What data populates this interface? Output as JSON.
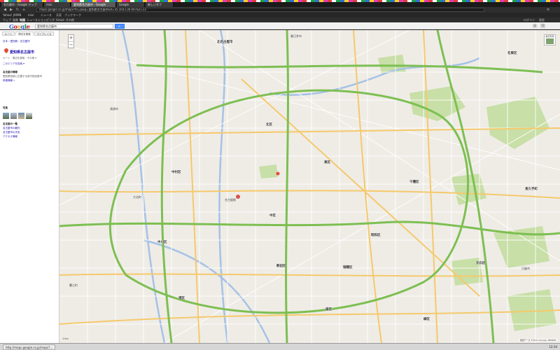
{
  "browser": {
    "tabs": [
      {
        "label": "名古屋市 - Google マップ",
        "active": false
      },
      {
        "label": "mixi",
        "active": false
      },
      {
        "label": "愛知県名古屋市 - Google",
        "active": true
      },
      {
        "label": "Google",
        "active": false
      },
      {
        "label": "新しいタブ",
        "active": false
      }
    ],
    "url": "maps.google.co.jp/maps?hl=ja&q=愛知県名古屋市&ll=35.164,136.907&z=13",
    "bookmarks": [
      "Yahoo! JAPAN",
      "mixi",
      "ニュース",
      "天気",
      "ブックマーク"
    ]
  },
  "gbar": {
    "items": [
      "ウェブ",
      "画像",
      "地図",
      "ニュース",
      "ショッピング",
      "Gmail",
      "その他"
    ],
    "right": [
      "ログイン",
      "設定"
    ]
  },
  "header": {
    "logo_letters": [
      {
        "ch": "G",
        "color": "#3369e8"
      },
      {
        "ch": "o",
        "color": "#d50f25"
      },
      {
        "ch": "o",
        "color": "#eeb211"
      },
      {
        "ch": "g",
        "color": "#3369e8"
      },
      {
        "ch": "l",
        "color": "#009925"
      },
      {
        "ch": "e",
        "color": "#d50f25"
      }
    ],
    "search_value": "愛知県名古屋市",
    "search_icon": "search-icon"
  },
  "panel": {
    "tabs": [
      "ルート",
      "周辺を検索",
      "マイプレイス"
    ],
    "breadcrumb": "日本 › 愛知県 › 名古屋市",
    "result_title": "愛知県名古屋市",
    "actions": "ルート · 周辺を検索 · その他 ▾",
    "more_info": "このエリアを探索 ▾",
    "section_label": "名古屋の情報",
    "desc_1": "愛知県西部に位置する政令指定都市",
    "desc_2": "詳細情報 »",
    "photos_label": "写真",
    "links_head": "名古屋の一覧",
    "links": [
      "名古屋市の観光",
      "名古屋市の天気",
      "アクセス情報"
    ]
  },
  "map": {
    "labels": [
      {
        "text": "北名古屋市",
        "ward": true
      },
      {
        "text": "春日井市",
        "ward": false
      },
      {
        "text": "名東区",
        "ward": true
      },
      {
        "text": "清須市",
        "ward": false
      },
      {
        "text": "北区",
        "ward": true
      },
      {
        "text": "中村区",
        "ward": true
      },
      {
        "text": "東区",
        "ward": true
      },
      {
        "text": "名古屋駅",
        "ward": false
      },
      {
        "text": "中区",
        "ward": true
      },
      {
        "text": "千種区",
        "ward": true
      },
      {
        "text": "長久手町",
        "ward": true
      },
      {
        "text": "大治町",
        "ward": false
      },
      {
        "text": "中川区",
        "ward": true
      },
      {
        "text": "昭和区",
        "ward": true
      },
      {
        "text": "瑞穂区",
        "ward": true
      },
      {
        "text": "天白区",
        "ward": true
      },
      {
        "text": "港区",
        "ward": true
      },
      {
        "text": "熱田区",
        "ward": true
      },
      {
        "text": "南区",
        "ward": true
      },
      {
        "text": "緑区",
        "ward": true
      },
      {
        "text": "蟹江町",
        "ward": false
      },
      {
        "text": "日進市",
        "ward": false
      }
    ],
    "controls": {
      "zoom_in": "+",
      "zoom_out": "−",
      "map_type": "航空写真"
    },
    "scale": "1 km",
    "attribution": "地図データ ©2011 Google, ZENRIN"
  },
  "status": {
    "text": "http://maps.google.co.jp/maps?...",
    "tray": "12:34"
  },
  "colors": {
    "highway": "#7dbf52",
    "major_road": "#f5c96b",
    "minor_road": "#ffffff",
    "park": "#c8dfa7",
    "river": "#a5c2e6"
  }
}
